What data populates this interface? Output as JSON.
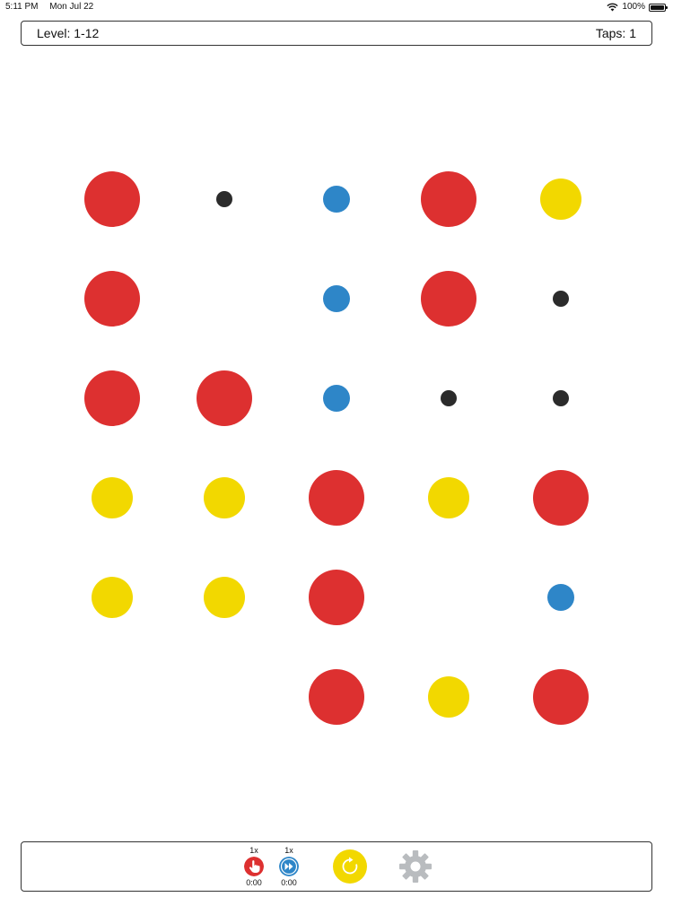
{
  "status_bar": {
    "time": "5:11 PM",
    "date": "Mon Jul 22",
    "battery": "100%",
    "icons": [
      "wifi-icon",
      "battery-icon"
    ]
  },
  "header": {
    "level_text": "Level: 1-12",
    "taps_text": "Taps: 1"
  },
  "colors": {
    "red": "#dd3030",
    "yellow": "#f2d800",
    "blue": "#2e86c8",
    "black": "#2b2b2b",
    "gear": "#b9bcbf"
  },
  "board": {
    "rows": 6,
    "cols": 5,
    "cells": [
      [
        "red-l",
        "black-xs",
        "blue-s",
        "red-l",
        "yellow-m"
      ],
      [
        "red-l",
        null,
        "blue-s",
        "red-l",
        "black-xs"
      ],
      [
        "red-l",
        "red-l",
        "blue-s",
        "black-xs",
        "black-xs"
      ],
      [
        "yellow-m",
        "yellow-m",
        "red-l",
        "yellow-m",
        "red-l"
      ],
      [
        "yellow-m",
        "yellow-m",
        "red-l",
        null,
        "blue-s"
      ],
      [
        null,
        null,
        "red-l",
        "yellow-m",
        "red-l"
      ]
    ]
  },
  "toolbar": {
    "tap_power": {
      "count": "1x",
      "timer": "0:00",
      "icon": "pointer-hand-icon"
    },
    "speed_power": {
      "count": "1x",
      "timer": "0:00",
      "icon": "fast-forward-icon"
    },
    "restart_icon": "restart-icon",
    "settings_icon": "gear-icon"
  }
}
